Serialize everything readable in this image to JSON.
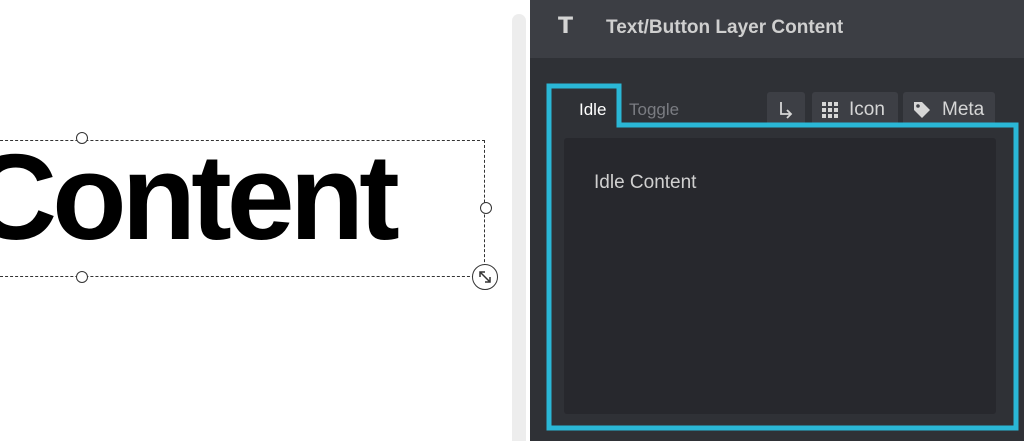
{
  "canvas": {
    "layer_text": "Content"
  },
  "panel": {
    "header": {
      "icon": "text-type-icon",
      "title": "Text/Button Layer Content"
    },
    "tabs": [
      {
        "label": "Idle",
        "active": true
      },
      {
        "label": "Toggle",
        "active": false
      }
    ],
    "tools": {
      "link_icon": "arrow-return-icon",
      "icon_label": "Icon",
      "meta_label": "Meta"
    },
    "content": {
      "text": "Idle Content"
    }
  },
  "colors": {
    "highlight": "#2ab7d6",
    "panel_bg": "#2f3136",
    "header_bg": "#3c3e44",
    "content_bg": "#27282d"
  }
}
